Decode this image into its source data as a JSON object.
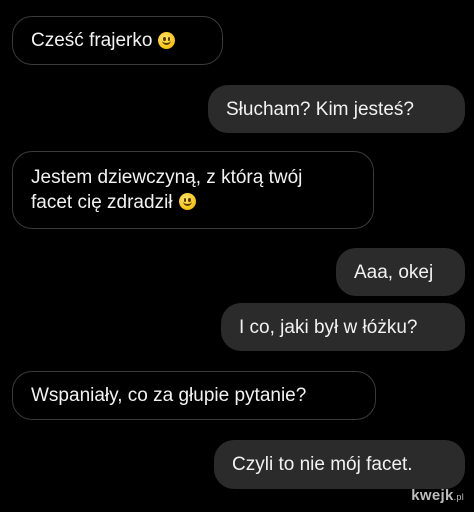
{
  "conversation": {
    "messages": [
      {
        "sender": "incoming",
        "text": "Cześć frajerko",
        "emoji": "smiling-face-emoji"
      },
      {
        "sender": "outgoing",
        "text": "Słucham? Kim jesteś?"
      },
      {
        "sender": "incoming",
        "line1": "Jestem dziewczyną, z którą twój",
        "line2": "facet cię zdradził",
        "emoji": "smiling-face-emoji"
      },
      {
        "sender": "outgoing",
        "text": "Aaa, okej"
      },
      {
        "sender": "outgoing",
        "text": "I co, jaki był w łóżku?"
      },
      {
        "sender": "incoming",
        "text": "Wspaniały, co za głupie pytanie?"
      },
      {
        "sender": "outgoing",
        "text": "Czyli to nie mój facet."
      }
    ]
  },
  "watermark": {
    "brand": "kwejk",
    "suffix": ".pl"
  },
  "colors": {
    "background": "#000000",
    "outgoing_bubble": "#2b2b2b",
    "incoming_border": "#3a3a3a",
    "text": "#f2f2f2",
    "emoji": "#f7c71c"
  }
}
